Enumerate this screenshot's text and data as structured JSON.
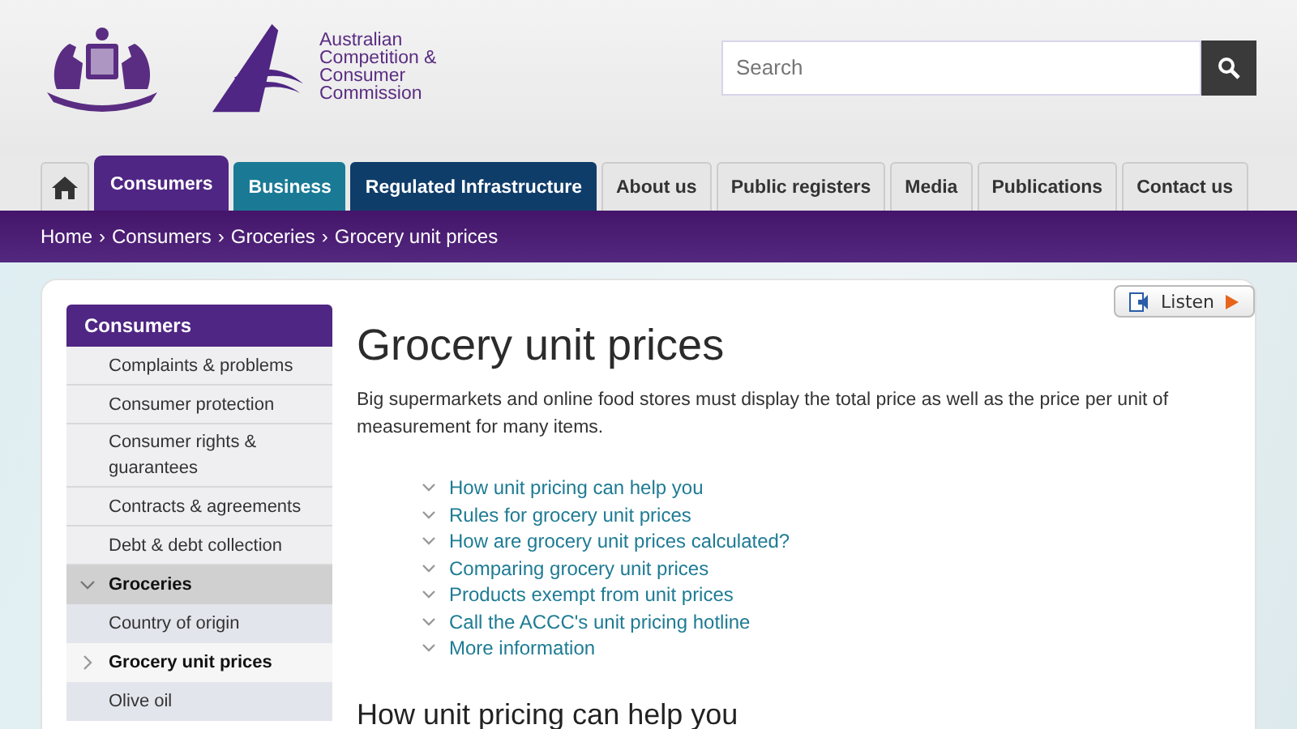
{
  "header": {
    "logo_text": "Australian Competition & Consumer Commission",
    "search": {
      "placeholder": "Search"
    }
  },
  "tabs": [
    {
      "kind": "home",
      "selected": false,
      "color": "#e6e6e6"
    },
    {
      "kind": "text",
      "label": "Consumers",
      "selected": true,
      "color": "#4f2683"
    },
    {
      "kind": "text",
      "label": "Business",
      "selected": false,
      "color": "#1a7a95"
    },
    {
      "kind": "text",
      "label": "Regulated Infrastructure",
      "selected": false,
      "color": "#0f3d6a"
    },
    {
      "kind": "text",
      "label": "About us",
      "selected": false,
      "color": "#e6e6e6"
    },
    {
      "kind": "text",
      "label": "Public registers",
      "selected": false,
      "color": "#e6e6e6"
    },
    {
      "kind": "text",
      "label": "Media",
      "selected": false,
      "color": "#e6e6e6"
    },
    {
      "kind": "text",
      "label": "Publications",
      "selected": false,
      "color": "#e6e6e6"
    },
    {
      "kind": "text",
      "label": "Contact us",
      "selected": false,
      "color": "#e6e6e6"
    }
  ],
  "breadcrumb": {
    "separator": "›",
    "items": [
      "Home",
      "Consumers",
      "Groceries",
      "Grocery unit prices"
    ]
  },
  "sidebar": {
    "title": "Consumers",
    "items": [
      {
        "label": "Complaints & problems",
        "selected": false
      },
      {
        "label": "Consumer protection",
        "selected": false
      },
      {
        "label": "Consumer rights & guarantees",
        "selected": false
      },
      {
        "label": "Contracts & agreements",
        "selected": false
      },
      {
        "label": "Debt & debt collection",
        "selected": false
      },
      {
        "label": "Groceries",
        "selected": false,
        "expanded": true,
        "children": [
          {
            "label": "Country of origin",
            "selected": false
          },
          {
            "label": "Grocery unit prices",
            "selected": true
          },
          {
            "label": "Olive oil",
            "selected": false
          }
        ]
      }
    ]
  },
  "listen_button": {
    "label": "Listen"
  },
  "page": {
    "title": "Grocery unit prices",
    "intro": "Big supermarkets and online food stores must display the total price as well as the price per unit of measurement for many items.",
    "links": [
      "How unit pricing can help you",
      "Rules for grocery unit prices",
      "How are grocery unit prices calculated?",
      "Comparing grocery unit prices",
      "Products exempt from unit prices",
      "Call the ACCC's unit pricing hotline",
      "More information"
    ],
    "section_heading": "How unit pricing can help you"
  }
}
